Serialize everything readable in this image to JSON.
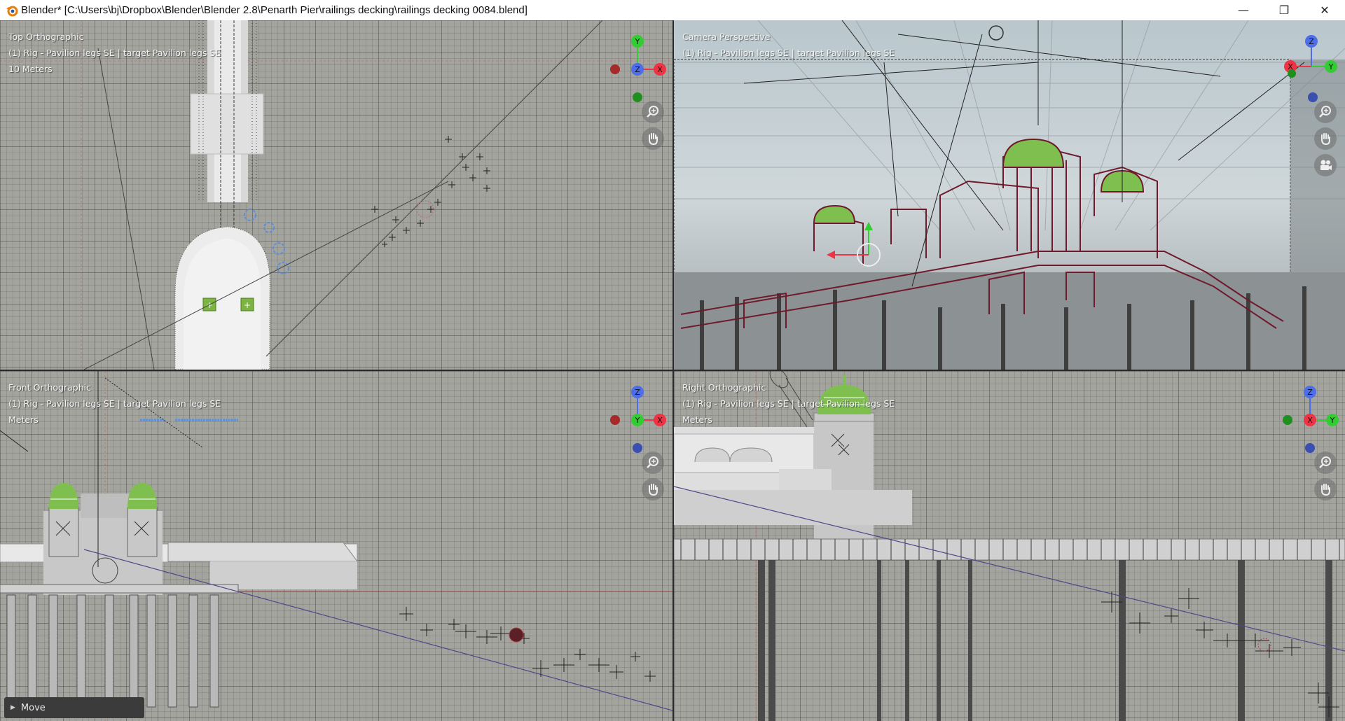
{
  "window": {
    "title": "Blender* [C:\\Users\\bj\\Dropbox\\Blender\\Blender 2.8\\Penarth Pier\\railings decking\\railings decking 0084.blend]",
    "minimize_glyph": "—",
    "maximize_glyph": "❐",
    "close_glyph": "✕"
  },
  "viewports": {
    "top": {
      "view_name": "Top Orthographic",
      "object_line": "(1) Rig - Pavilion legs SE | target Pavilion legs SE",
      "scale_label": "10 Meters",
      "gizmo_axes": [
        "Y",
        "Z",
        "X"
      ]
    },
    "camera": {
      "view_name": "Camera Perspective",
      "object_line": "(1) Rig - Pavilion legs SE | target Pavilion legs SE",
      "gizmo_axes": [
        "Z",
        "X",
        "Y"
      ]
    },
    "front": {
      "view_name": "Front Orthographic",
      "object_line": "(1) Rig - Pavilion legs SE | target Pavilion legs SE",
      "scale_label": "Meters",
      "gizmo_axes": [
        "Z",
        "Y",
        "X"
      ]
    },
    "right": {
      "view_name": "Right Orthographic",
      "object_line": "(1) Rig - Pavilion legs SE | target Pavilion legs SE",
      "scale_label": "Meters",
      "gizmo_axes": [
        "Z",
        "X",
        "Y"
      ]
    }
  },
  "operator_panel": {
    "label": "Move"
  },
  "icons": {
    "zoom": "zoom-icon",
    "pan": "hand-icon",
    "camera": "camera-icon"
  },
  "colors": {
    "axis_x": "#ee3344",
    "axis_y": "#33cc33",
    "axis_z": "#4d6ee8",
    "viewport_bg": "#a4a49f",
    "outline": "#6e1a2c",
    "dome_green": "#7fbf4f"
  }
}
